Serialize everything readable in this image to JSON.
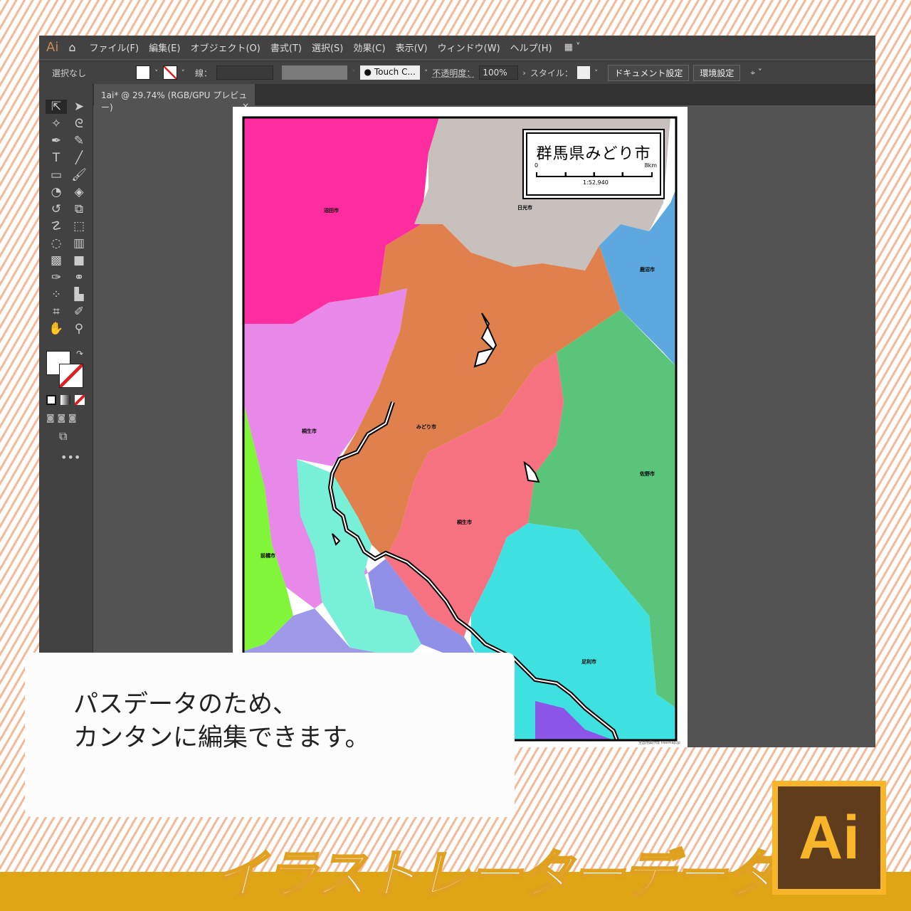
{
  "menu": {
    "logo": "Ai",
    "items": [
      "ファイル(F)",
      "編集(E)",
      "オブジェクト(O)",
      "書式(T)",
      "選択(S)",
      "効果(C)",
      "表示(V)",
      "ウィンドウ(W)",
      "ヘルプ(H)"
    ]
  },
  "control": {
    "selection": "選択なし",
    "stroke_label": "線：",
    "brush": "Touch C...",
    "opacity_label": "不透明度：",
    "opacity": "100%",
    "style_label": "スタイル：",
    "doc_settings": "ドキュメント設定",
    "preferences": "環境設定"
  },
  "tab": {
    "title": "1ai* @ 29.74% (RGB/GPU プレビュー)",
    "close": "×"
  },
  "map": {
    "title": "群馬県みどり市",
    "scale_start": "0",
    "scale_end": "8km",
    "scale_ratio": "1:52,940",
    "credit": "全国地図作成 freemap.jp",
    "labels": [
      "沼田市",
      "日光市",
      "鹿沼市",
      "桐生市",
      "みどり市",
      "桐生市",
      "佐野市",
      "前橋市",
      "足利市"
    ],
    "colors": {
      "magenta": "#ff2d9f",
      "gray": "#c7c0bd",
      "blue": "#5ea8e0",
      "orange": "#e0804d",
      "green": "#5ac47a",
      "salmon": "#f77280",
      "cyan": "#3fe0e0",
      "violet": "#8b55e8",
      "pink": "#e888e8",
      "lime": "#80f53a",
      "aqua": "#78f0d8",
      "lavender": "#9090e8",
      "lilac": "#a098e8"
    }
  },
  "callout": {
    "line1": "パスデータのため、",
    "line2": "カンタンに編集できます。"
  },
  "banner": {
    "title": "イラストレーターデータ",
    "logo": "Ai"
  }
}
